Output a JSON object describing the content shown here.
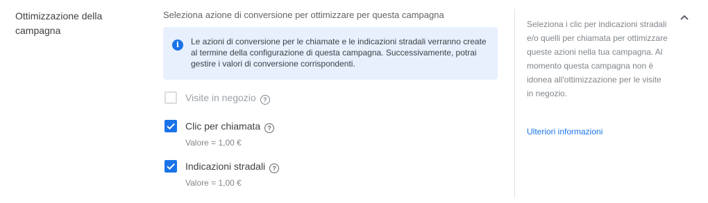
{
  "section": {
    "title": "Ottimizzazione della campagna",
    "instruction": "Seleziona azione di conversione per ottimizzare per questa campagna"
  },
  "info_box": {
    "icon": "info-icon",
    "text": "Le azioni di conversione per le chiamate e le indicazioni stradali verranno create al termine della configurazione di questa campagna. Successivamente, potrai gestire i valori di conversione corrispondenti."
  },
  "options": [
    {
      "label": "Visite in negozio",
      "checked": false,
      "disabled": true,
      "help_icon": "help-icon"
    },
    {
      "label": "Clic per chiamata",
      "checked": true,
      "disabled": false,
      "help_icon": "help-icon",
      "value": "Valore = 1,00 €"
    },
    {
      "label": "Indicazioni stradali",
      "checked": true,
      "disabled": false,
      "help_icon": "help-icon",
      "value": "Valore = 1,00 €"
    }
  ],
  "side_panel": {
    "help_text": "Seleziona i clic per indicazioni stradali e/o quelli per chiamata per ottimizzare queste azioni nella tua campagna. Al momento questa campagna non è idonea all'ottimizzazione per le visite in negozio.",
    "link_label": "Ulteriori informazioni",
    "collapse_icon": "chevron-up-icon"
  },
  "colors": {
    "accent": "#1a73e8",
    "info_background": "#e8f0fe",
    "text": "#3c4043",
    "secondary_text": "#5f6368",
    "muted_text": "#80868b"
  }
}
